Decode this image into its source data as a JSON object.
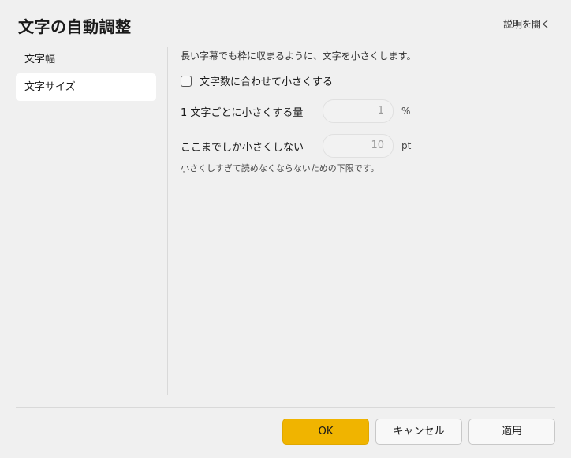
{
  "dialog": {
    "title": "文字の自動調整",
    "help_link": "説明を開く"
  },
  "sidebar": {
    "items": [
      {
        "label": "文字幅",
        "active": false
      },
      {
        "label": "文字サイズ",
        "active": true
      }
    ]
  },
  "main": {
    "description": "長い字幕でも枠に収まるように、文字を小さくします。",
    "checkbox": {
      "label": "文字数に合わせて小さくする",
      "checked": false
    },
    "fields": [
      {
        "label": "1 文字ごとに小さくする量",
        "value": "1",
        "unit": "%"
      },
      {
        "label": "ここまでしか小さくしない",
        "value": "10",
        "unit": "pt"
      }
    ],
    "hint": "小さくしすぎて読めなくならないための下限です。"
  },
  "footer": {
    "ok_label": "OK",
    "cancel_label": "キャンセル",
    "apply_label": "適用"
  },
  "colors": {
    "accent": "#f0b400",
    "background": "#f0f0f0",
    "active_item": "#ffffff"
  }
}
